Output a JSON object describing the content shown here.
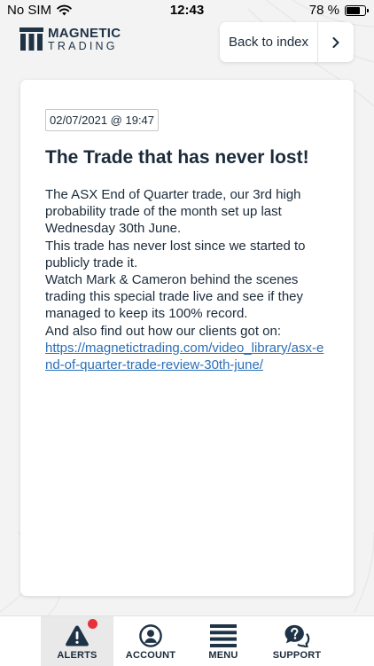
{
  "status_bar": {
    "carrier": "No SIM",
    "time": "12:43",
    "battery": "78 %",
    "battery_level": 0.78
  },
  "logo": {
    "line1": "MAGNETIC",
    "line2": "TRADING"
  },
  "header": {
    "back_label": "Back to index"
  },
  "alert": {
    "date": "02/07/2021 @ 19:47",
    "title": "The Trade that has never lost!",
    "paragraphs": [
      "The ASX End of Quarter trade, our 3rd high probability trade of the month set up last Wednesday 30th June.",
      "This trade has never lost since we started to publicly trade it.",
      "Watch Mark & Cameron behind the scenes trading this special trade live and see if they managed to keep its 100% record.",
      "And also find out how our clients got on:"
    ],
    "link": "https://magnetictrading.com/video_library/asx-end-of-quarter-trade-review-30th-june/"
  },
  "tabs": [
    {
      "label": "ALERTS",
      "icon": "alert-icon",
      "active": true,
      "has_badge": true
    },
    {
      "label": "ACCOUNT",
      "icon": "account-icon",
      "active": false
    },
    {
      "label": "MENU",
      "icon": "menu-icon",
      "active": false
    },
    {
      "label": "SUPPORT",
      "icon": "support-icon",
      "active": false
    }
  ],
  "colors": {
    "brand": "#1f3347",
    "link": "#2a6fb8",
    "badge": "#e8303a"
  }
}
